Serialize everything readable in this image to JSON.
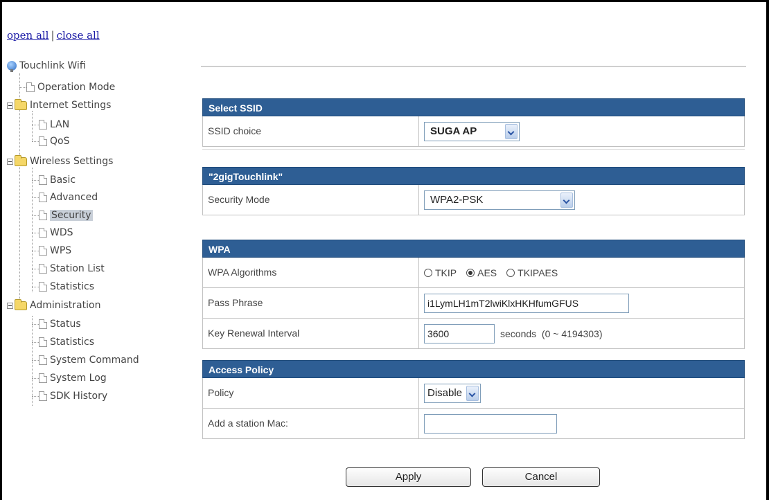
{
  "nav": {
    "open_all": "open all",
    "separator": "|",
    "close_all": "close all",
    "root": "Touchlink Wifi",
    "items": [
      {
        "label": "Operation Mode"
      },
      {
        "label": "Internet Settings"
      },
      {
        "label": "LAN"
      },
      {
        "label": "QoS"
      },
      {
        "label": "Wireless Settings"
      },
      {
        "label": "Basic"
      },
      {
        "label": "Advanced"
      },
      {
        "label": "Security"
      },
      {
        "label": "WDS"
      },
      {
        "label": "WPS"
      },
      {
        "label": "Station List"
      },
      {
        "label": "Statistics"
      },
      {
        "label": "Administration"
      },
      {
        "label": "Status"
      },
      {
        "label": "Statistics"
      },
      {
        "label": "System Command"
      },
      {
        "label": "System Log"
      },
      {
        "label": "SDK History"
      }
    ],
    "selected": "Security"
  },
  "ssid_section": {
    "header": "Select SSID",
    "label": "SSID choice",
    "value": "SUGA AP"
  },
  "network_section": {
    "header": "\"2gigTouchlink\"",
    "label": "Security Mode",
    "value": "WPA2-PSK"
  },
  "wpa_section": {
    "header": "WPA",
    "algorithms_label": "WPA Algorithms",
    "algorithms": [
      {
        "label": "TKIP",
        "checked": false
      },
      {
        "label": "AES",
        "checked": true
      },
      {
        "label": "TKIPAES",
        "checked": false
      }
    ],
    "pass_label": "Pass Phrase",
    "pass_value": "i1LymLH1mT2lwiKlxHKHfumGFUS",
    "renewal_label": "Key Renewal Interval",
    "renewal_value": "3600",
    "renewal_hint": "seconds  (0 ~ 4194303)"
  },
  "access_section": {
    "header": "Access Policy",
    "policy_label": "Policy",
    "policy_value": "Disable",
    "mac_label": "Add a station Mac:",
    "mac_value": ""
  },
  "buttons": {
    "apply": "Apply",
    "cancel": "Cancel"
  }
}
